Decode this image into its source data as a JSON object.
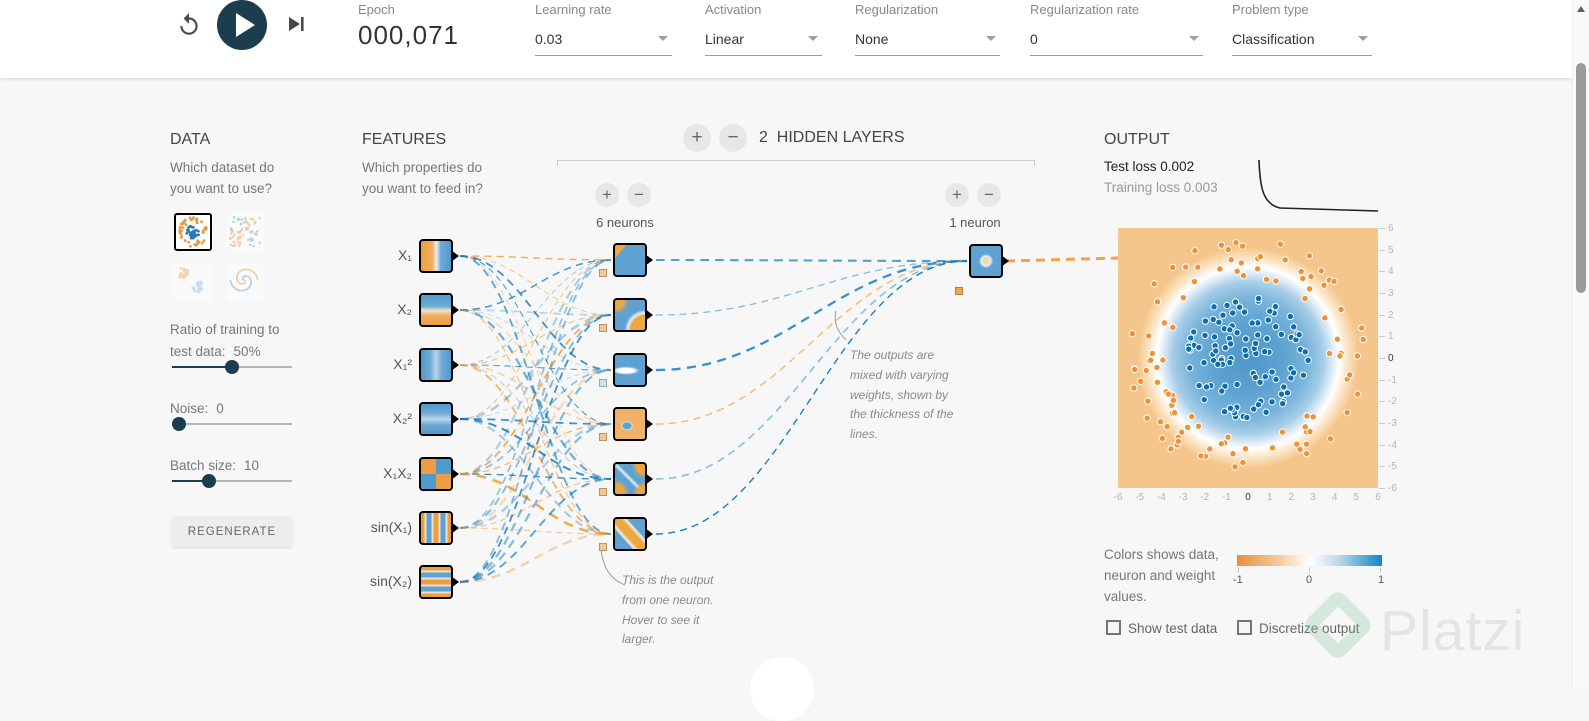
{
  "colors": {
    "accent_blue": "#0877bd",
    "accent_orange": "#f59322",
    "play_button": "#1b3d4e"
  },
  "topbar": {
    "epoch": {
      "label": "Epoch",
      "value": "000,071"
    },
    "selects": [
      {
        "id": "learning-rate",
        "label": "Learning rate",
        "value": "0.03"
      },
      {
        "id": "activation",
        "label": "Activation",
        "value": "Linear"
      },
      {
        "id": "regularization",
        "label": "Regularization",
        "value": "None"
      },
      {
        "id": "regularization-rate",
        "label": "Regularization rate",
        "value": "0"
      },
      {
        "id": "problem-type",
        "label": "Problem type",
        "value": "Classification"
      }
    ]
  },
  "data_panel": {
    "title": "DATA",
    "question": "Which dataset do you want to use?",
    "datasets": [
      {
        "name": "circle",
        "selected": true
      },
      {
        "name": "exclusive-or",
        "selected": false
      },
      {
        "name": "gaussian",
        "selected": false
      },
      {
        "name": "spiral",
        "selected": false
      }
    ],
    "sliders": [
      {
        "label": "Ratio of training to test data:",
        "value": "50%",
        "percent": 50
      },
      {
        "label": "Noise:",
        "value": "0",
        "percent": 0
      },
      {
        "label": "Batch size:",
        "value": "10",
        "percent": 31
      }
    ],
    "regenerate_label": "REGENERATE"
  },
  "features_panel": {
    "title": "FEATURES",
    "question": "Which properties do you want to feed in?",
    "features": [
      "X₁",
      "X₂",
      "X₁²",
      "X₂²",
      "X₁X₂",
      "sin(X₁)",
      "sin(X₂)"
    ]
  },
  "network": {
    "add_label": "+",
    "remove_label": "−",
    "hidden_layers_count": "2",
    "hidden_layers_label": "HIDDEN LAYERS",
    "layers": [
      {
        "neurons_label": "6 neurons",
        "count": 6
      },
      {
        "neurons_label": "1 neuron",
        "count": 1
      }
    ],
    "annotation_weights": "The outputs are mixed with varying weights, shown by the thickness of the lines.",
    "annotation_neuron": "This is the output from one neuron. Hover to see it larger."
  },
  "output_panel": {
    "title": "OUTPUT",
    "test_loss_label": "Test loss",
    "test_loss_value": "0.002",
    "training_loss_label": "Training loss",
    "training_loss_value": "0.003",
    "x_ticks": [
      "-6",
      "-5",
      "-4",
      "-3",
      "-2",
      "-1",
      "0",
      "1",
      "2",
      "3",
      "4",
      "5",
      "6"
    ],
    "y_ticks": [
      "6",
      "5",
      "4",
      "3",
      "2",
      "1",
      "0",
      "-1",
      "-2",
      "-3",
      "-4",
      "-5",
      "-6"
    ],
    "legend_text": "Colors shows data, neuron and weight values.",
    "scale_ticks": [
      "-1",
      "0",
      "1"
    ],
    "checkboxes": [
      {
        "label": "Show test data",
        "checked": false
      },
      {
        "label": "Discretize output",
        "checked": false
      }
    ]
  },
  "watermark": {
    "brand": "Platzi"
  }
}
